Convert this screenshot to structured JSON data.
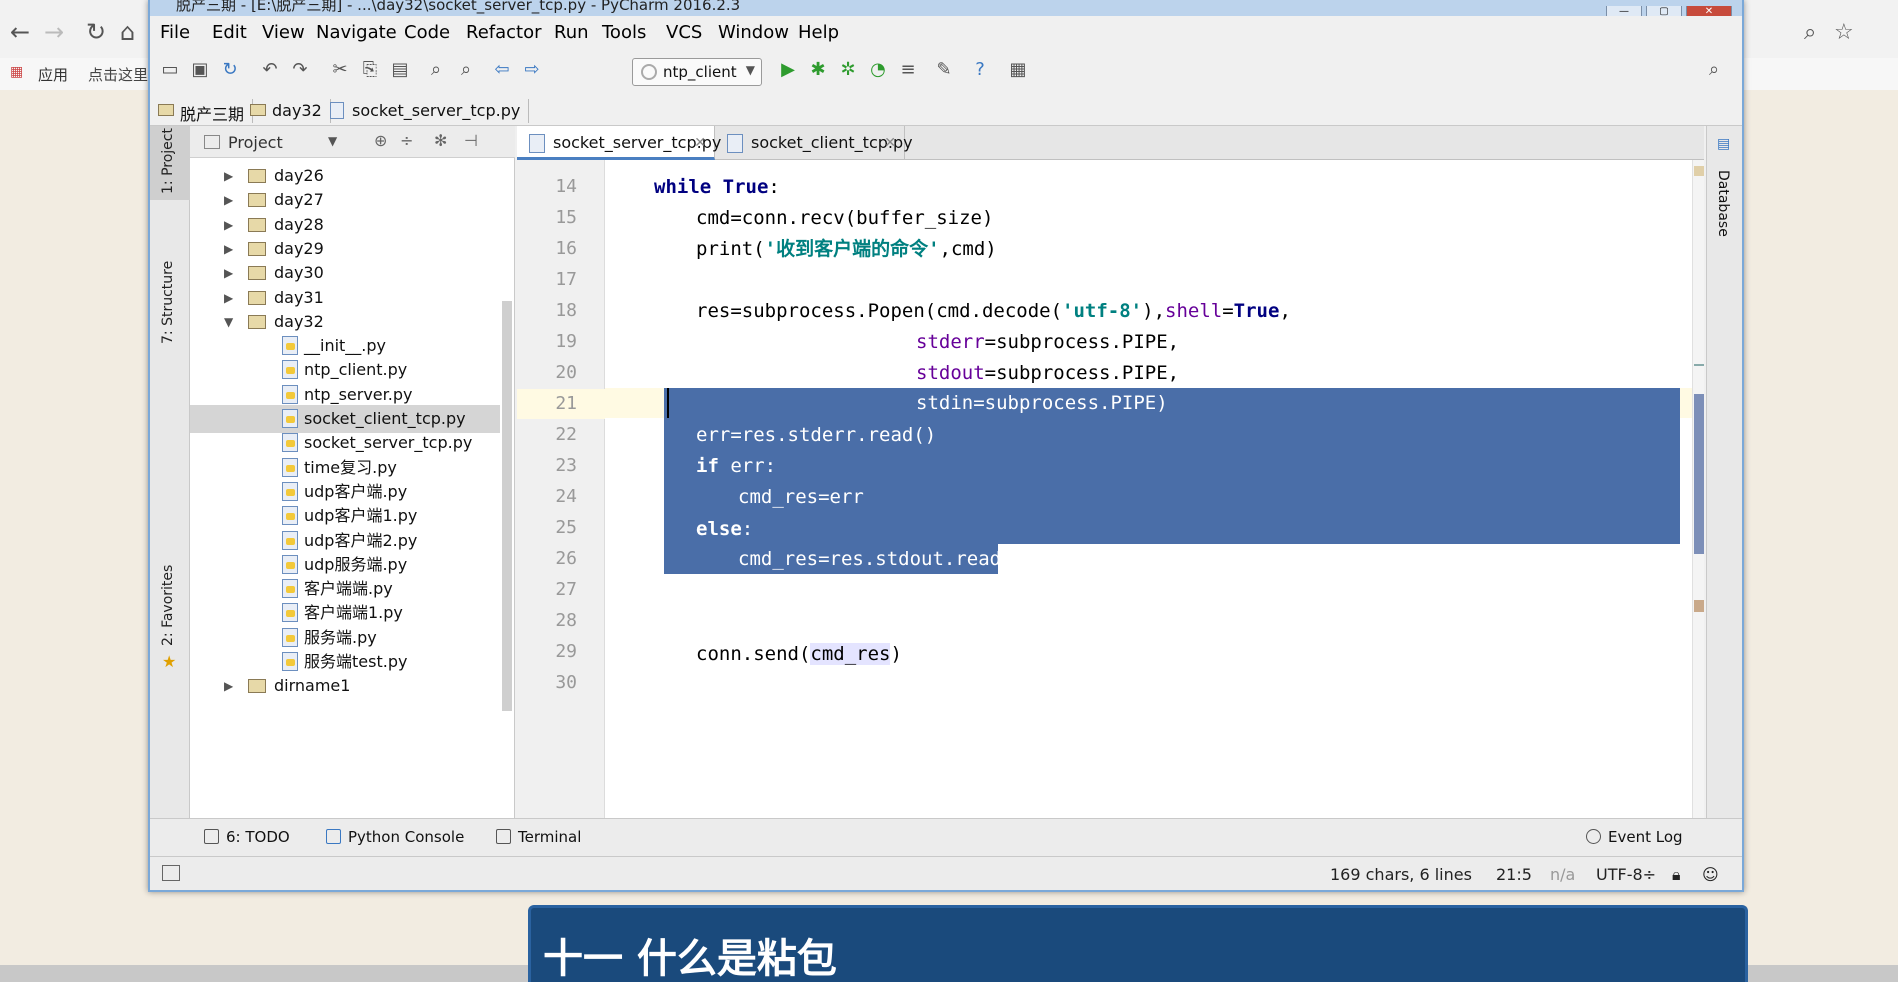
{
  "browser": {
    "bookmarks": [
      "应用",
      "点击这里"
    ]
  },
  "window": {
    "title": "脱产三期 - [E:\\脱产三期] - ...\\day32\\socket_server_tcp.py - PyCharm 2016.2.3"
  },
  "menu": [
    "File",
    "Edit",
    "View",
    "Navigate",
    "Code",
    "Refactor",
    "Run",
    "Tools",
    "VCS",
    "Window",
    "Help"
  ],
  "toolbar": {
    "run_config": "ntp_client"
  },
  "breadcrumb": [
    "脱产三期",
    "day32",
    "socket_server_tcp.py"
  ],
  "left_stripe": {
    "project_tab": "1: Project",
    "structure_tab": "7: Structure",
    "favorites_tab": "2: Favorites"
  },
  "project_pane": {
    "header": "Project",
    "tree": [
      {
        "type": "folder",
        "label": "day26",
        "expanded": false
      },
      {
        "type": "folder",
        "label": "day27",
        "expanded": false
      },
      {
        "type": "folder",
        "label": "day28",
        "expanded": false
      },
      {
        "type": "folder",
        "label": "day29",
        "expanded": false
      },
      {
        "type": "folder",
        "label": "day30",
        "expanded": false
      },
      {
        "type": "folder",
        "label": "day31",
        "expanded": false
      },
      {
        "type": "folder",
        "label": "day32",
        "expanded": true
      },
      {
        "type": "file",
        "label": "__init__.py"
      },
      {
        "type": "file",
        "label": "ntp_client.py"
      },
      {
        "type": "file",
        "label": "ntp_server.py"
      },
      {
        "type": "file",
        "label": "socket_client_tcp.py",
        "selected": true
      },
      {
        "type": "file",
        "label": "socket_server_tcp.py"
      },
      {
        "type": "file",
        "label": "time复习.py"
      },
      {
        "type": "file",
        "label": "udp客户端.py"
      },
      {
        "type": "file",
        "label": "udp客户端1.py"
      },
      {
        "type": "file",
        "label": "udp客户端2.py"
      },
      {
        "type": "file",
        "label": "udp服务端.py"
      },
      {
        "type": "file",
        "label": "客户端端.py"
      },
      {
        "type": "file",
        "label": "客户端端1.py"
      },
      {
        "type": "file",
        "label": "服务端.py"
      },
      {
        "type": "file",
        "label": "服务端test.py"
      },
      {
        "type": "folder",
        "label": "dirname1",
        "expanded": false
      }
    ]
  },
  "editor": {
    "tabs": [
      {
        "label": "socket_server_tcp.py",
        "active": true
      },
      {
        "label": "socket_client_tcp.py",
        "active": false
      }
    ],
    "line_numbers": [
      "14",
      "15",
      "16",
      "17",
      "18",
      "19",
      "20",
      "21",
      "22",
      "23",
      "24",
      "25",
      "26",
      "27",
      "28",
      "29",
      "30"
    ]
  },
  "right_stripe": {
    "database_tab": "Database"
  },
  "bottom_tools": {
    "todo": "6: TODO",
    "python_console": "Python Console",
    "terminal": "Terminal",
    "event_log": "Event Log"
  },
  "status": {
    "selection": "169 chars, 6 lines",
    "position": "21:5",
    "na": "n/a",
    "encoding": "UTF-8÷"
  },
  "banner": {
    "text": "十一 什么是粘包"
  },
  "colors": {
    "selection": "#4a6ea8",
    "keyword": "#000080",
    "string": "#008080",
    "banner": "#1a4a7c"
  }
}
